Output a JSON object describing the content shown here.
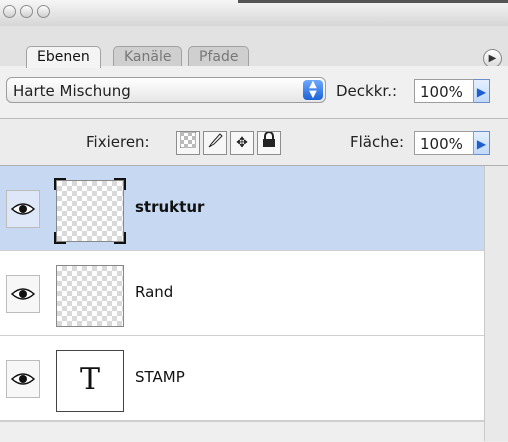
{
  "window": {
    "title": ""
  },
  "tabs": [
    {
      "label": "Ebenen",
      "active": true
    },
    {
      "label": "Kanäle",
      "active": false
    },
    {
      "label": "Pfade",
      "active": false
    }
  ],
  "blend": {
    "mode": "Harte Mischung",
    "opacity_label": "Deckkr.:",
    "opacity_value": "100%"
  },
  "lock": {
    "label": "Fixieren:",
    "fill_label": "Fläche:",
    "fill_value": "100%"
  },
  "layers": [
    {
      "name": "struktur",
      "selected": true,
      "thumbnail": "transparent",
      "visible": true
    },
    {
      "name": "Rand",
      "selected": false,
      "thumbnail": "transparent",
      "visible": true
    },
    {
      "name": "STAMP",
      "selected": false,
      "thumbnail": "text",
      "thumb_glyph": "T",
      "visible": true
    }
  ],
  "icons": {
    "lock_transparent": "checkerboard-icon",
    "lock_image": "brush-icon",
    "lock_position": "move-icon",
    "lock_all": "padlock-icon",
    "visibility": "eye-icon",
    "panel_menu": "triangle-menu-icon"
  },
  "colors": {
    "selection": "#c7d8f3",
    "accent_blue": "#1c63d6"
  }
}
